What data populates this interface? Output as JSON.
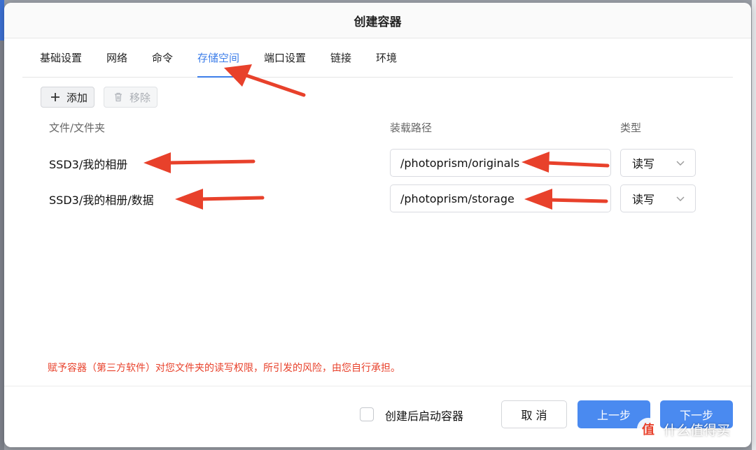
{
  "dialog": {
    "title": "创建容器"
  },
  "tabs": [
    {
      "label": "基础设置",
      "active": false
    },
    {
      "label": "网络",
      "active": false
    },
    {
      "label": "命令",
      "active": false
    },
    {
      "label": "存储空间",
      "active": true
    },
    {
      "label": "端口设置",
      "active": false
    },
    {
      "label": "链接",
      "active": false
    },
    {
      "label": "环境",
      "active": false
    }
  ],
  "toolbar": {
    "add_label": "添加",
    "add_icon": "plus-icon",
    "remove_label": "移除",
    "remove_icon": "trash-icon"
  },
  "columns": {
    "file": "文件/文件夹",
    "mount": "装载路径",
    "type": "类型"
  },
  "rows": [
    {
      "file": "SSD3/我的相册",
      "mount_path": "/photoprism/originals",
      "type": "读写"
    },
    {
      "file": "SSD3/我的相册/数据",
      "mount_path": "/photoprism/storage",
      "type": "读写"
    }
  ],
  "warning": "赋予容器（第三方软件）对您文件夹的读写权限，所引发的风险，由您自行承担。",
  "footer": {
    "autostart_label": "创建后启动容器",
    "autostart_checked": false,
    "cancel_label": "取 消",
    "prev_label": "上一步",
    "next_label": "下一步"
  },
  "watermark": {
    "logo": "值",
    "text": "什么值得买"
  },
  "colors": {
    "accent": "#3d7ee9",
    "primary_button": "#4a8af0",
    "warning": "#e8412b",
    "annotation_arrow": "#e8412b"
  }
}
